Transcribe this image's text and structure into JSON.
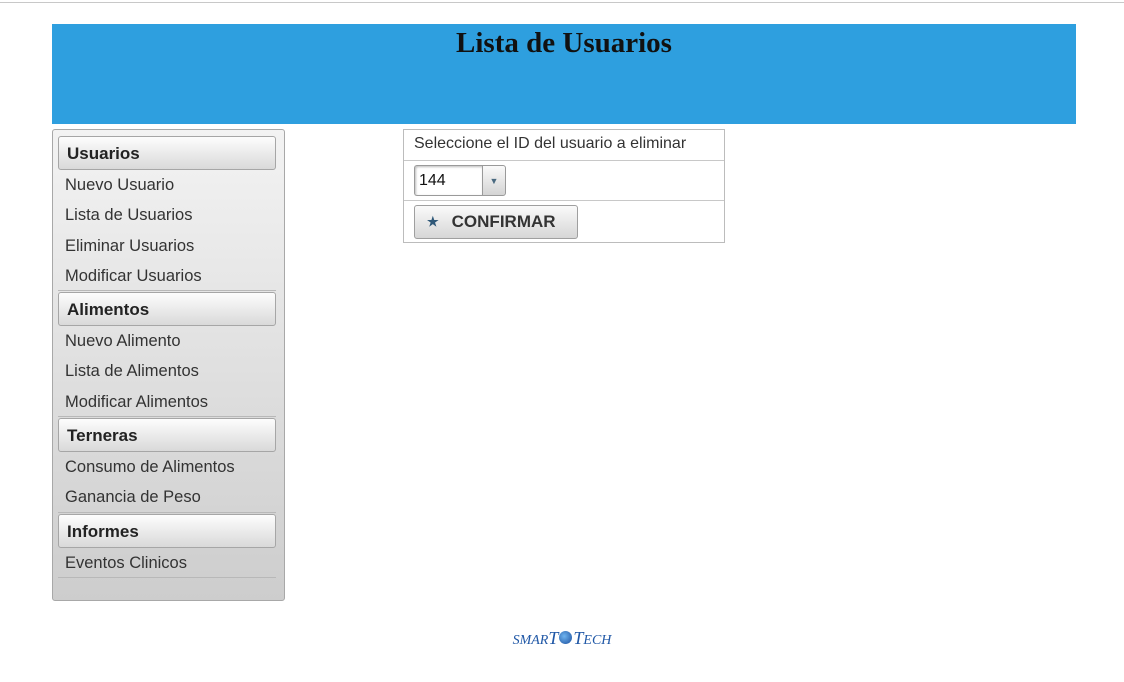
{
  "header": {
    "title": "Lista de Usuarios"
  },
  "sidebar": {
    "sections": [
      {
        "title": "Usuarios",
        "items": [
          "Nuevo Usuario",
          "Lista de Usuarios",
          "Eliminar Usuarios",
          "Modificar Usuarios"
        ]
      },
      {
        "title": "Alimentos",
        "items": [
          "Nuevo Alimento",
          "Lista de Alimentos",
          "Modificar Alimentos"
        ]
      },
      {
        "title": "Terneras",
        "items": [
          "Consumo de Alimentos",
          "Ganancia de Peso"
        ]
      },
      {
        "title": "Informes",
        "items": [
          "Eventos Clinicos"
        ]
      }
    ]
  },
  "form": {
    "label": "Seleccione el ID del usuario a eliminar",
    "selected_id": "144",
    "confirm_label": "CONFIRMAR",
    "confirm_icon": "star-icon"
  },
  "footer": {
    "logo_parts": [
      "SMAR",
      "T",
      "T",
      "ECH"
    ]
  },
  "colors": {
    "header_bg": "#2e9fdf",
    "logo": "#1f57a6"
  }
}
